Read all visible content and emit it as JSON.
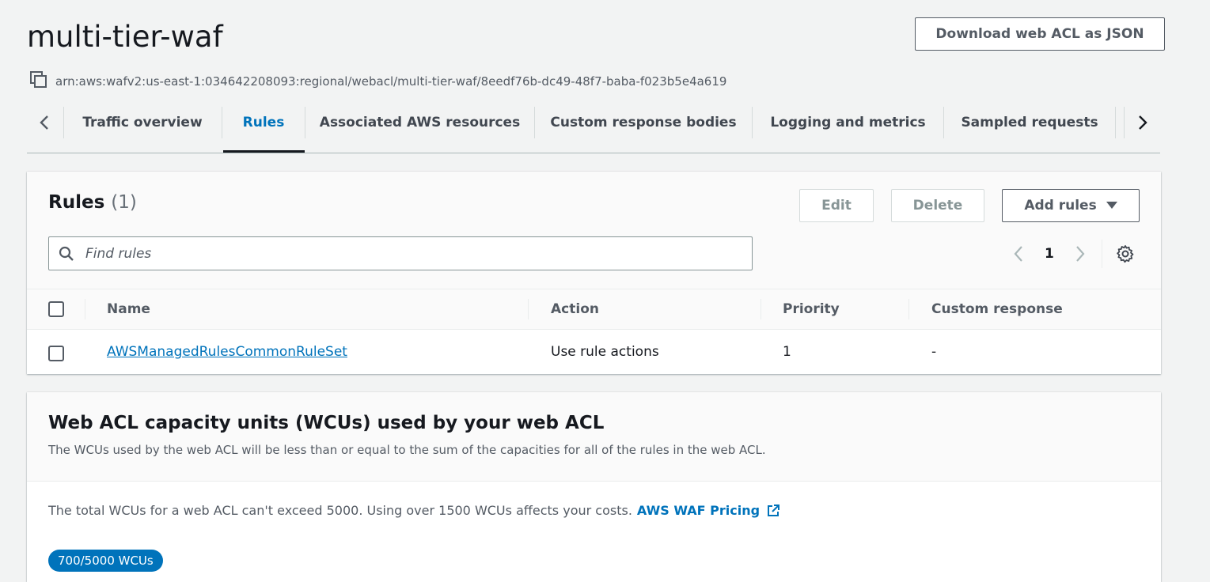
{
  "page": {
    "title": "multi-tier-waf",
    "download_button": "Download web ACL as JSON",
    "arn": "arn:aws:wafv2:us-east-1:034642208093:regional/webacl/multi-tier-waf/8eedf76b-dc49-48f7-baba-f023b5e4a619",
    "copy_icon": "copy-icon"
  },
  "tabs": [
    {
      "label": "Traffic overview",
      "active": false
    },
    {
      "label": "Rules",
      "active": true
    },
    {
      "label": "Associated AWS resources",
      "active": false
    },
    {
      "label": "Custom response bodies",
      "active": false
    },
    {
      "label": "Logging and metrics",
      "active": false
    },
    {
      "label": "Sampled requests",
      "active": false
    }
  ],
  "rules_panel": {
    "title": "Rules",
    "count": "(1)",
    "edit_label": "Edit",
    "delete_label": "Delete",
    "add_rules_label": "Add rules",
    "search_placeholder": "Find rules",
    "page_number": "1",
    "columns": [
      "Name",
      "Action",
      "Priority",
      "Custom response"
    ],
    "rows": [
      {
        "name": "AWSManagedRulesCommonRuleSet",
        "action": "Use rule actions",
        "priority": "1",
        "custom_response": "-"
      }
    ]
  },
  "wcu_panel": {
    "title": "Web ACL capacity units (WCUs) used by your web ACL",
    "description": "The WCUs used by the web ACL will be less than or equal to the sum of the capacities for all of the rules in the web ACL.",
    "note": "The total WCUs for a web ACL can't exceed 5000. Using over 1500 WCUs affects your costs.",
    "pricing_link": "AWS WAF Pricing",
    "usage_badge": "700/5000 WCUs"
  },
  "colors": {
    "link": "#0073bb",
    "text": "#16191f",
    "muted": "#545b64",
    "background": "#f2f3f3"
  }
}
